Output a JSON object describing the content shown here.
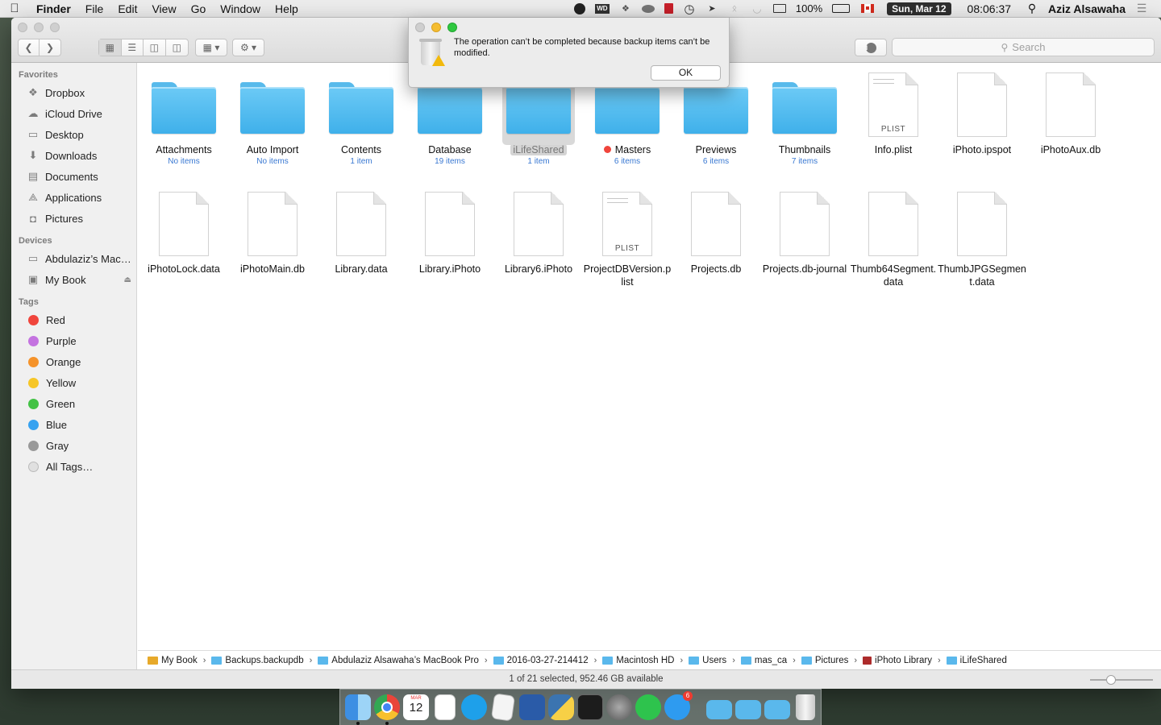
{
  "menubar": {
    "apple": "",
    "app_name": "Finder",
    "menus": [
      "File",
      "Edit",
      "View",
      "Go",
      "Window",
      "Help"
    ],
    "battery": "100%",
    "date": "Sun, Mar 12",
    "time": "08:06:37",
    "user": "Aziz Alsawaha"
  },
  "toolbar": {
    "search_placeholder": "Search"
  },
  "sidebar": {
    "favorites_header": "Favorites",
    "favorites": [
      {
        "label": "Dropbox",
        "icon": "dropbox-icon"
      },
      {
        "label": "iCloud Drive",
        "icon": "cloud-icon"
      },
      {
        "label": "Desktop",
        "icon": "desktop-icon"
      },
      {
        "label": "Downloads",
        "icon": "download-icon"
      },
      {
        "label": "Documents",
        "icon": "document-icon"
      },
      {
        "label": "Applications",
        "icon": "applications-icon"
      },
      {
        "label": "Pictures",
        "icon": "camera-icon"
      }
    ],
    "devices_header": "Devices",
    "devices": [
      {
        "label": "Abdulaziz’s Mac…",
        "icon": "laptop-icon"
      },
      {
        "label": "My Book",
        "icon": "drive-icon"
      }
    ],
    "tags_header": "Tags",
    "tags": [
      {
        "label": "Red",
        "color": "#f0453c"
      },
      {
        "label": "Purple",
        "color": "#c473e0"
      },
      {
        "label": "Orange",
        "color": "#f5932a"
      },
      {
        "label": "Yellow",
        "color": "#f6c627"
      },
      {
        "label": "Green",
        "color": "#43c245"
      },
      {
        "label": "Blue",
        "color": "#37a2f0"
      },
      {
        "label": "Gray",
        "color": "#999999"
      },
      {
        "label": "All Tags…",
        "color": "#e0e0e0"
      }
    ]
  },
  "items": [
    {
      "name": "Attachments",
      "sub": "No items",
      "kind": "folder"
    },
    {
      "name": "Auto Import",
      "sub": "No items",
      "kind": "folder"
    },
    {
      "name": "Contents",
      "sub": "1 item",
      "kind": "folder"
    },
    {
      "name": "Database",
      "sub": "19 items",
      "kind": "folder"
    },
    {
      "name": "iLifeShared",
      "sub": "1 item",
      "kind": "folder",
      "selected": true
    },
    {
      "name": "Masters",
      "sub": "6 items",
      "kind": "folder",
      "tag": "#f0453c"
    },
    {
      "name": "Previews",
      "sub": "6 items",
      "kind": "folder"
    },
    {
      "name": "Thumbnails",
      "sub": "7 items",
      "kind": "folder"
    },
    {
      "name": "Info.plist",
      "sub": "",
      "kind": "plist",
      "label": "PLIST"
    },
    {
      "name": "iPhoto.ipspot",
      "sub": "",
      "kind": "doc"
    },
    {
      "name": "iPhotoAux.db",
      "sub": "",
      "kind": "doc"
    },
    {
      "name": "iPhotoLock.data",
      "sub": "",
      "kind": "doc"
    },
    {
      "name": "iPhotoMain.db",
      "sub": "",
      "kind": "doc"
    },
    {
      "name": "Library.data",
      "sub": "",
      "kind": "doc"
    },
    {
      "name": "Library.iPhoto",
      "sub": "",
      "kind": "doc"
    },
    {
      "name": "Library6.iPhoto",
      "sub": "",
      "kind": "doc"
    },
    {
      "name": "ProjectDBVersion.plist",
      "sub": "",
      "kind": "plist",
      "label": "PLIST"
    },
    {
      "name": "Projects.db",
      "sub": "",
      "kind": "doc"
    },
    {
      "name": "Projects.db-journal",
      "sub": "",
      "kind": "doc"
    },
    {
      "name": "Thumb64Segment.data",
      "sub": "",
      "kind": "doc"
    },
    {
      "name": "ThumbJPGSegment.data",
      "sub": "",
      "kind": "doc"
    }
  ],
  "pathbar": [
    {
      "label": "My Book",
      "kind": "drive"
    },
    {
      "label": "Backups.backupdb",
      "kind": "folder"
    },
    {
      "label": "Abdulaziz Alsawaha’s MacBook Pro",
      "kind": "folder"
    },
    {
      "label": "2016-03-27-214412",
      "kind": "folder"
    },
    {
      "label": "Macintosh HD",
      "kind": "folder"
    },
    {
      "label": "Users",
      "kind": "folder"
    },
    {
      "label": "mas_ca",
      "kind": "folder"
    },
    {
      "label": "Pictures",
      "kind": "folder"
    },
    {
      "label": "iPhoto Library",
      "kind": "lib"
    },
    {
      "label": "iLifeShared",
      "kind": "folder"
    }
  ],
  "status": "1 of 21 selected, 952.46 GB available",
  "alert": {
    "message": "The operation can’t be completed because backup items can’t be modified.",
    "ok_label": "OK"
  },
  "dock": {
    "calendar_month": "MAR",
    "calendar_day": "12",
    "messages_badge": "6",
    "apps": [
      "finder-icon",
      "chrome-icon",
      "calendar-icon",
      "reminders-icon",
      "skype-icon",
      "textedit-icon",
      "word-icon",
      "python-icon",
      "terminal-icon",
      "system-preferences-icon",
      "whatsapp-icon",
      "messenger-icon"
    ],
    "stacks": [
      "applications-folder-icon",
      "documents-folder-icon",
      "downloads-folder-icon",
      "trash-icon"
    ]
  }
}
